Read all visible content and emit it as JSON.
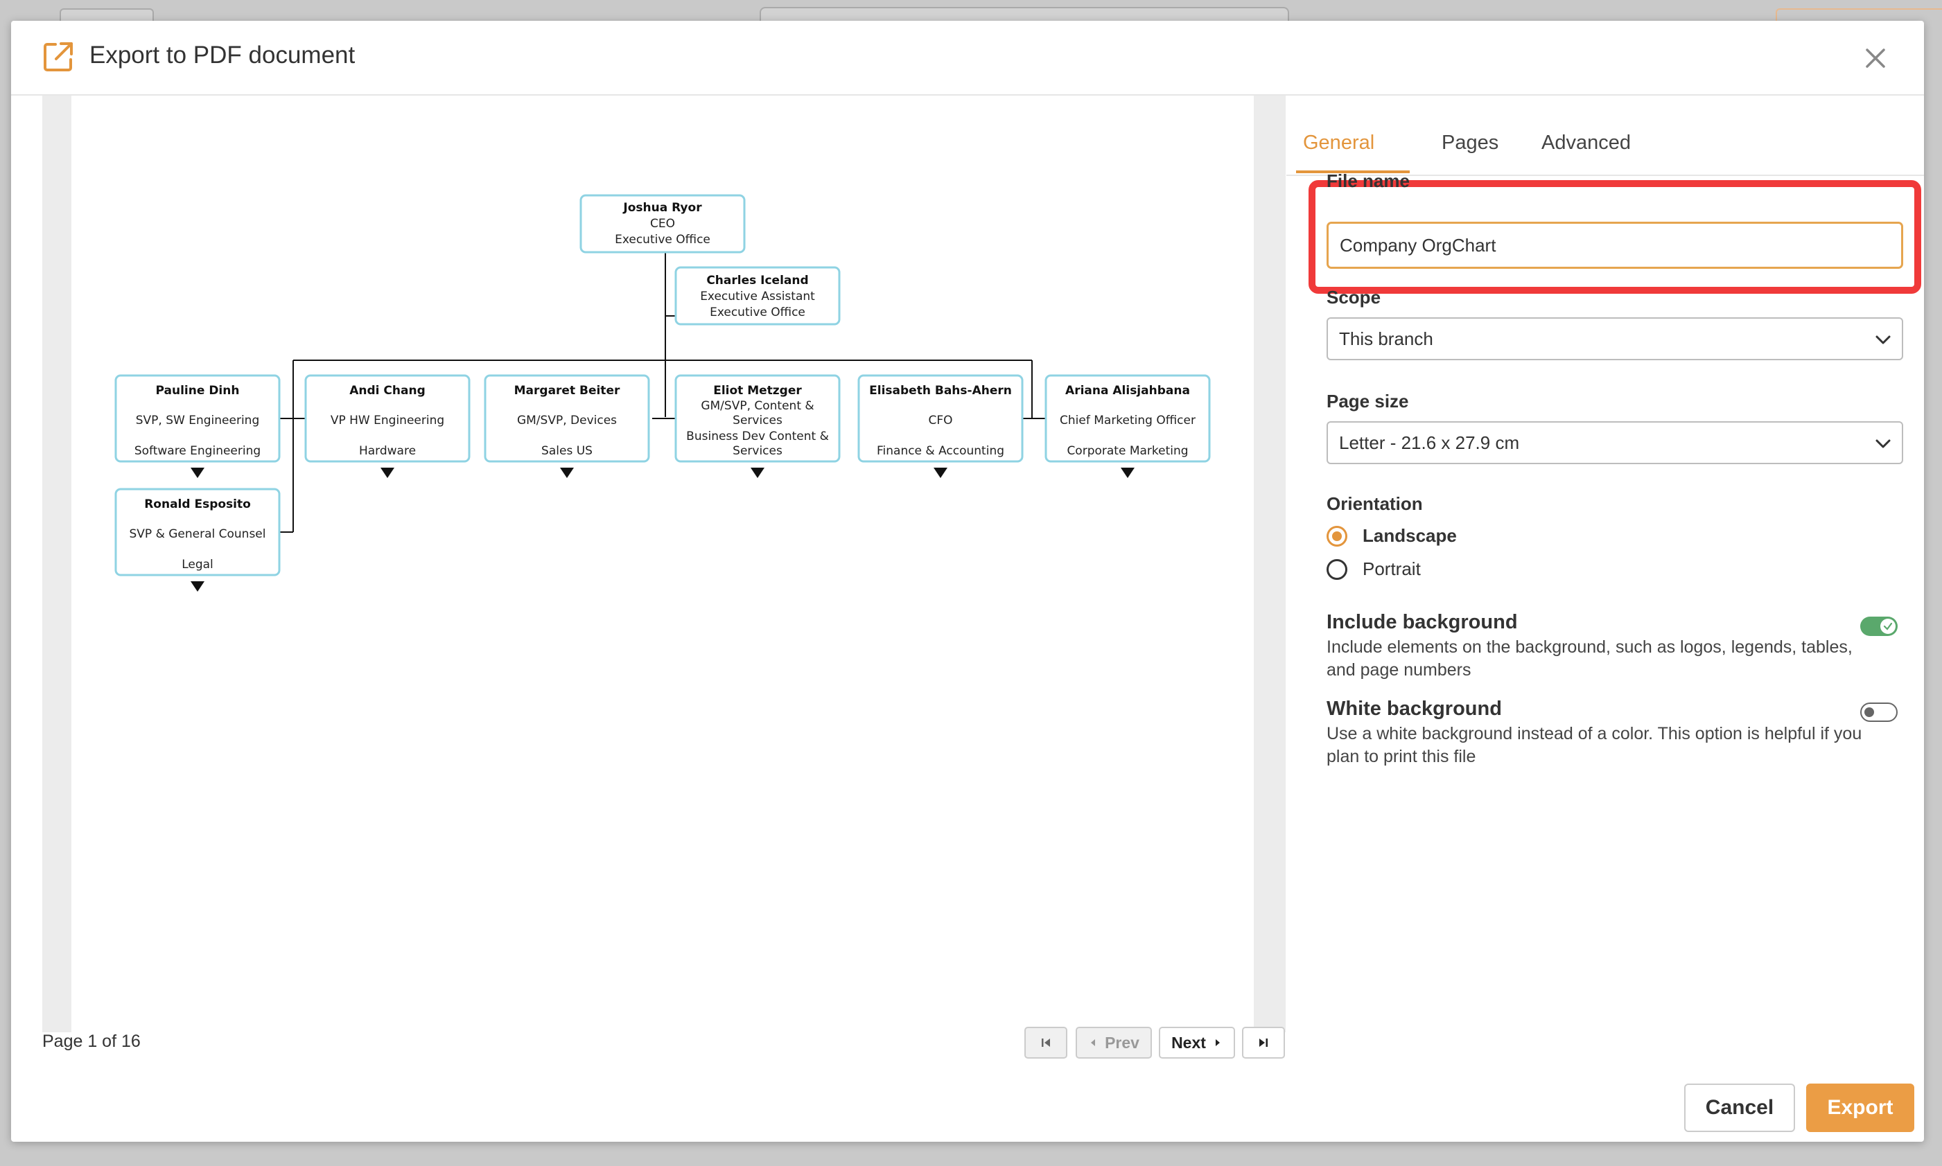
{
  "dialog": {
    "title": "Export to PDF document"
  },
  "preview": {
    "page_info": "Page 1 of 16",
    "prev_label": "Prev",
    "next_label": "Next"
  },
  "org_chart": {
    "ceo": {
      "name": "Joshua Ryor",
      "title": "CEO",
      "dept": "Executive Office"
    },
    "assistant": {
      "name": "Charles Iceland",
      "title": "Executive Assistant",
      "dept": "Executive Office"
    },
    "pauline": {
      "name": "Pauline Dinh",
      "title": "SVP, SW Engineering",
      "dept": "Software Engineering"
    },
    "andi": {
      "name": "Andi Chang",
      "title": "VP HW Engineering",
      "dept": "Hardware"
    },
    "margaret": {
      "name": "Margaret Beiter",
      "title": "GM/SVP, Devices",
      "dept": "Sales US"
    },
    "eliot": {
      "name": "Eliot Metzger",
      "title_line1": "GM/SVP, Content &",
      "title_line2": "Services",
      "dept_line1": "Business Dev Content &",
      "dept_line2": "Services"
    },
    "elisabeth": {
      "name": "Elisabeth Bahs-Ahern",
      "title": "CFO",
      "dept": "Finance & Accounting"
    },
    "ariana": {
      "name": "Ariana Alisjahbana",
      "title": "Chief Marketing Officer",
      "dept": "Corporate Marketing"
    },
    "ronald": {
      "name": "Ronald Esposito",
      "title": "SVP & General Counsel",
      "dept": "Legal"
    }
  },
  "tabs": [
    {
      "label": "General"
    },
    {
      "label": "Pages"
    },
    {
      "label": "Advanced"
    }
  ],
  "form": {
    "file_name_label": "File name",
    "file_name_value": "Company OrgChart",
    "scope_label": "Scope",
    "scope_value": "This branch",
    "page_size_label": "Page size",
    "page_size_value": "Letter - 21.6 x 27.9 cm",
    "orientation_label": "Orientation",
    "orientation_landscape": "Landscape",
    "orientation_portrait": "Portrait",
    "include_bg_title": "Include background",
    "include_bg_desc": "Include elements on the background, such as logos, legends, tables, and page numbers",
    "white_bg_title": "White background",
    "white_bg_desc": "Use a white background instead of a color. This option is helpful if you plan to print this file"
  },
  "actions": {
    "cancel_label": "Cancel",
    "export_label": "Export"
  },
  "colors": {
    "accent": "#e3953c",
    "highlight": "#f03a3a",
    "toggle_on": "#5aa86c",
    "node_border": "#8fd3e3"
  }
}
